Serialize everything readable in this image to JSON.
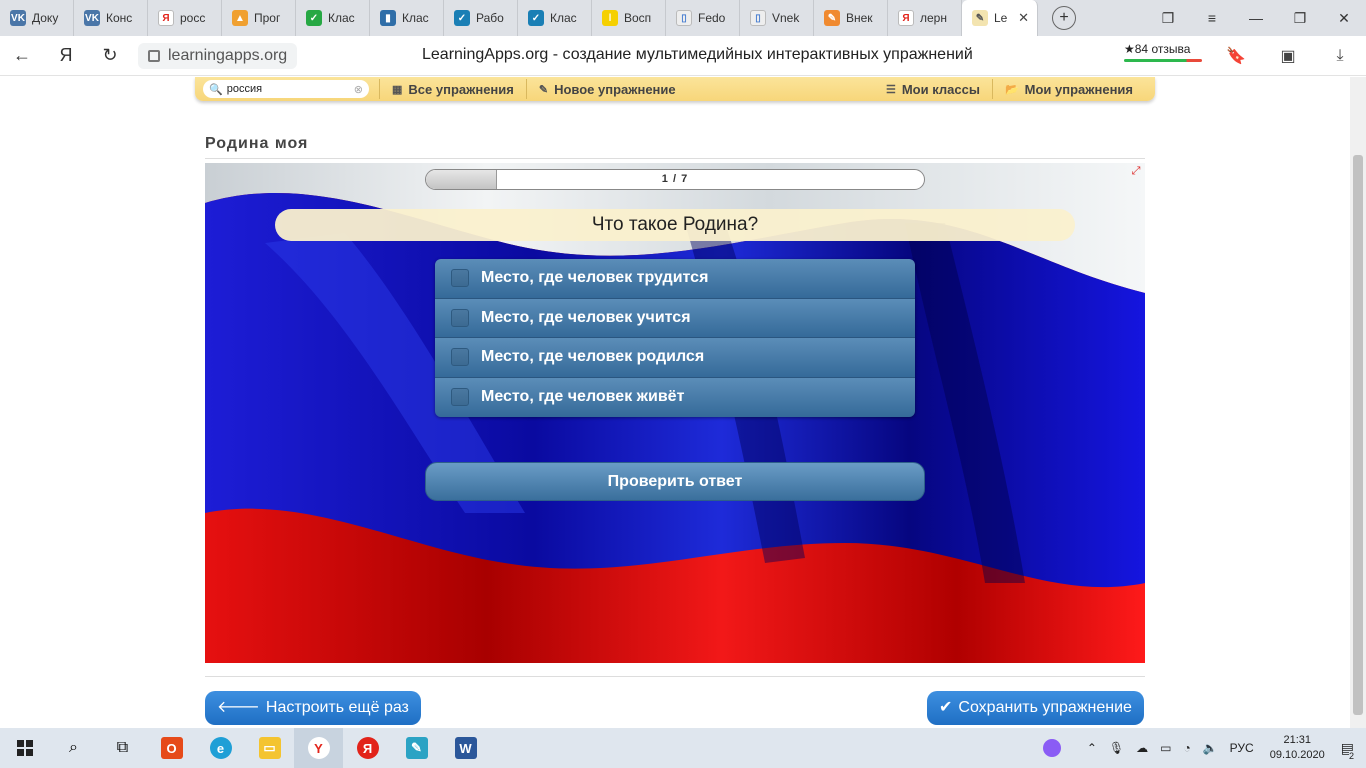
{
  "browser": {
    "tabs": [
      {
        "label": "Доку",
        "icon": "vk-icon",
        "color": "#4a76a8",
        "glyph": "VK"
      },
      {
        "label": "Конс",
        "icon": "vk-icon",
        "color": "#4a76a8",
        "glyph": "VK"
      },
      {
        "label": "росс",
        "icon": "yandex-icon",
        "color": "#ffffff",
        "glyph": "Я"
      },
      {
        "label": "Прог",
        "icon": "hat-icon",
        "color": "#f0a030",
        "glyph": "▲"
      },
      {
        "label": "Клас",
        "icon": "check-circle-icon",
        "color": "#27a844",
        "glyph": "✓"
      },
      {
        "label": "Клас",
        "icon": "book-icon",
        "color": "#2f6ea8",
        "glyph": "▮"
      },
      {
        "label": "Рабо",
        "icon": "check-icon",
        "color": "#1a7fb5",
        "glyph": "✓"
      },
      {
        "label": "Клас",
        "icon": "check-icon",
        "color": "#1a7fb5",
        "glyph": "✓"
      },
      {
        "label": "Восп",
        "icon": "pencil-icon",
        "color": "#f5d000",
        "glyph": "ǀ"
      },
      {
        "label": "Fedo",
        "icon": "doc-icon",
        "color": "#eeeeee",
        "glyph": "▯"
      },
      {
        "label": "Vnek",
        "icon": "doc-icon",
        "color": "#eeeeee",
        "glyph": "▯"
      },
      {
        "label": "Внек",
        "icon": "pencil-icon",
        "color": "#f08a30",
        "glyph": "✎"
      },
      {
        "label": "лерн",
        "icon": "yandex-icon",
        "color": "#ffffff",
        "glyph": "Я"
      }
    ],
    "active_tab": {
      "label": "Le"
    },
    "url": "learningapps.org",
    "page_title": "LearningApps.org - создание мультимедийных интерактивных упражнений",
    "reviews": "★84 отзыва"
  },
  "site": {
    "search_value": "россия",
    "nav": [
      "Все упражнения",
      "Новое упражнение",
      "Мои классы",
      "Мои упражнения"
    ]
  },
  "app": {
    "title": "Родина моя",
    "progress": {
      "text": "1 / 7",
      "current": 1,
      "total": 7
    },
    "question": "Что такое Родина?",
    "answers": [
      "Место, где человек трудится",
      "Место, где человек учится",
      "Место, где человек родился",
      "Место, где человек живёт"
    ],
    "check_button": "Проверить ответ"
  },
  "footer": {
    "left_button": "Настроить ещё раз",
    "right_button": "Сохранить упражнение"
  },
  "taskbar": {
    "lang": "РУС",
    "time": "21:31",
    "date": "09.10.2020",
    "notifications": "2"
  }
}
